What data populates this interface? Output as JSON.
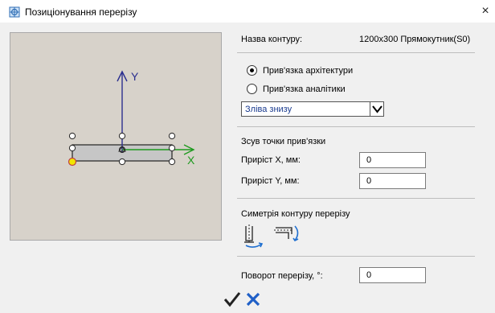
{
  "window": {
    "title": "Позиціонування перерізу",
    "close_glyph": "×",
    "icon": "section-icon"
  },
  "preview": {
    "axis_x_label": "X",
    "axis_y_label": "Y",
    "colors": {
      "axis_x": "#1f9a1f",
      "axis_y": "#2b2f8f",
      "anchor": "#f2e600",
      "background": "#d7d2ca"
    }
  },
  "contour": {
    "label": "Назва контуру:",
    "value": "1200x300 Прямокутник(S0)"
  },
  "binding": {
    "options": [
      {
        "label": "Прив'язка архітектури",
        "selected": true
      },
      {
        "label": "Прив'язка аналітики",
        "selected": false
      }
    ],
    "position_select": {
      "value": "Зліва знизу"
    }
  },
  "offset": {
    "title": "Зсув точки прив'язки",
    "dx_label": "Приріст X, мм:",
    "dx_value": "0",
    "dy_label": "Приріст Y, мм:",
    "dy_value": "0"
  },
  "symmetry": {
    "title": "Симетрія контуру перерізу",
    "icons": [
      "mirror-vertical-icon",
      "mirror-horizontal-icon"
    ]
  },
  "rotation": {
    "label": "Поворот перерізу, °:",
    "value": "0"
  },
  "actions": {
    "ok_icon": "checkmark-icon",
    "cancel_icon": "cross-icon",
    "ok_color": "#222222",
    "cancel_color": "#1f5fc7"
  }
}
